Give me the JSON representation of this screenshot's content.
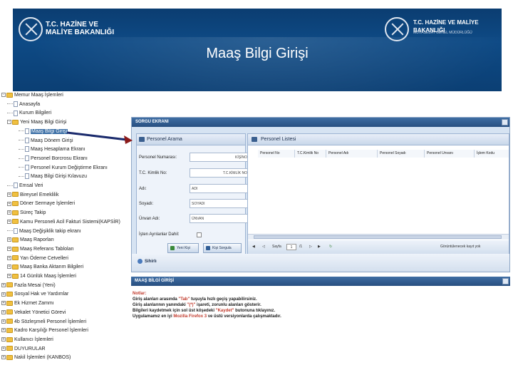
{
  "banner": {
    "left_logo_line1": "T.C. HAZİNE VE",
    "left_logo_line2": "MALİYE BAKANLIĞI",
    "right_logo_line1": "T.C. HAZİNE VE MALİYE BAKANLIĞI",
    "right_logo_line2": "MUHASEBAT GENEL MÜDÜRLÜĞÜ",
    "title": "Maaş Bilgi Girişi"
  },
  "tree": {
    "items": [
      {
        "label": "Memur Maaş İşlemleri",
        "type": "folder",
        "exp": "-"
      },
      {
        "label": "Anasayfa",
        "type": "page"
      },
      {
        "label": "Kurum Bilgileri",
        "type": "page"
      },
      {
        "label": "Yeni Maaş Bilgi Girişi",
        "type": "folder",
        "exp": "-"
      },
      {
        "label": "Maaş Bilgi Girişi",
        "type": "page",
        "selected": true
      },
      {
        "label": "Maaş Dönem Girişi",
        "type": "page"
      },
      {
        "label": "Maaş Hesaplama Ekranı",
        "type": "page"
      },
      {
        "label": "Personel Borcrosu Ekranı",
        "type": "page"
      },
      {
        "label": "Personel Kurum Değiştirme Ekranı",
        "type": "page"
      },
      {
        "label": "Maaş Bilgi Girişi Kılavuzu",
        "type": "page"
      },
      {
        "label": "Emsal Veri",
        "type": "page"
      },
      {
        "label": "Bireysel Emeklilik",
        "type": "folder",
        "exp": "+"
      },
      {
        "label": "Döner Sermaye İşlemleri",
        "type": "folder",
        "exp": "+"
      },
      {
        "label": "Süreç Takip",
        "type": "folder",
        "exp": "+"
      },
      {
        "label": "Kamu Personeli Acil Fakturi Sistemi(KAPSİR)",
        "type": "folder",
        "exp": "+"
      },
      {
        "label": "Maaş Değişiklik takip ekranı",
        "type": "page"
      },
      {
        "label": "Maaş Raporları",
        "type": "folder",
        "exp": "+"
      },
      {
        "label": "Maaş Referans Tabloları",
        "type": "folder",
        "exp": "+"
      },
      {
        "label": "Yan Ödeme Cetvelleri",
        "type": "folder",
        "exp": "+"
      },
      {
        "label": "Maaş Banka Aktarım Bilgileri",
        "type": "folder",
        "exp": "+"
      },
      {
        "label": "14 Günlük Maaş İşlemleri",
        "type": "folder",
        "exp": "+"
      },
      {
        "label": "Fazla Mesai (Yeni)",
        "type": "folder",
        "exp": "+"
      },
      {
        "label": "Sosyal Hak ve Yardımlar",
        "type": "folder",
        "exp": "+"
      },
      {
        "label": "Ek Hizmet Zammı",
        "type": "folder",
        "exp": "+"
      },
      {
        "label": "Vekalet Yönetici Görevi",
        "type": "folder",
        "exp": "+"
      },
      {
        "label": "4b Sözleşmeli Personel İşlemleri",
        "type": "folder",
        "exp": "+"
      },
      {
        "label": "Kadro Karşılığı Personel İşlemleri",
        "type": "folder",
        "exp": "+"
      },
      {
        "label": "Kullanıcı İşlemleri",
        "type": "folder",
        "exp": "+"
      },
      {
        "label": "DUYURULAR",
        "type": "folder",
        "exp": "+"
      },
      {
        "label": "Nakil İşlemleri (KANBOS)",
        "type": "folder",
        "exp": "+"
      }
    ]
  },
  "main": {
    "bar_title": "SORGU EKRANI",
    "search": {
      "title": "Personel Arama",
      "fields": [
        {
          "label": "Personel Numarası:",
          "value": "KİŞİNO"
        },
        {
          "label": "T.C. Kimlik No:",
          "value": "T.C.KİMLİK NO"
        },
        {
          "label": "Adı:",
          "value": "ADI"
        },
        {
          "label": "Soyadı:",
          "value": "SOYADI"
        },
        {
          "label": "Ünvan Adı:",
          "value": "ÜNVAN"
        },
        {
          "label": "İşten Ayrılanlar Dahil:",
          "value": ""
        }
      ],
      "btn_new": "Yeni Kişi",
      "btn_query": "Kişi Sorgula",
      "footer": "Sihirlı"
    },
    "list": {
      "title": "Personel Listesi",
      "columns": [
        "Personel No",
        "T.C.Kimlik No",
        "Personel Adı",
        "Personel Soyadı",
        "Personel Unvanı",
        "İşlem Kodu"
      ],
      "pager_label": "Sayfa",
      "page": "1",
      "of_label": "/1",
      "status": "Görüntülenecek kayıt yok"
    }
  },
  "maas": {
    "bar_title": "MAAŞ BİLGİ GİRİŞİ",
    "notes_title": "Notlar:",
    "note1_a": "Giriş alanları arasında ",
    "note1_b": "\"Tab\"",
    "note1_c": " tuşuyla hızlı geçiş yapabilirsiniz.",
    "note2_a": "Giriş alanlarının yanındaki ",
    "note2_b": "\"(*)\"",
    "note2_c": " işareti, zorunlu alanları gösterir.",
    "note3_a": "Bilgileri kaydetmek için sol üst köşedeki ",
    "note3_b": "\"Kaydet\"",
    "note3_c": " butonuna tıklayınız.",
    "note4_a": "Uygulamamız en iyi ",
    "note4_b": "Mozilla Firefox 3",
    "note4_c": " ve üstü versiyonlarda çalışmaktadır."
  },
  "colors": {
    "banner": "#0e4a85",
    "header_bar": "#3f6da3",
    "arrow": "#1a2a6c",
    "note_red": "#c0392b"
  }
}
